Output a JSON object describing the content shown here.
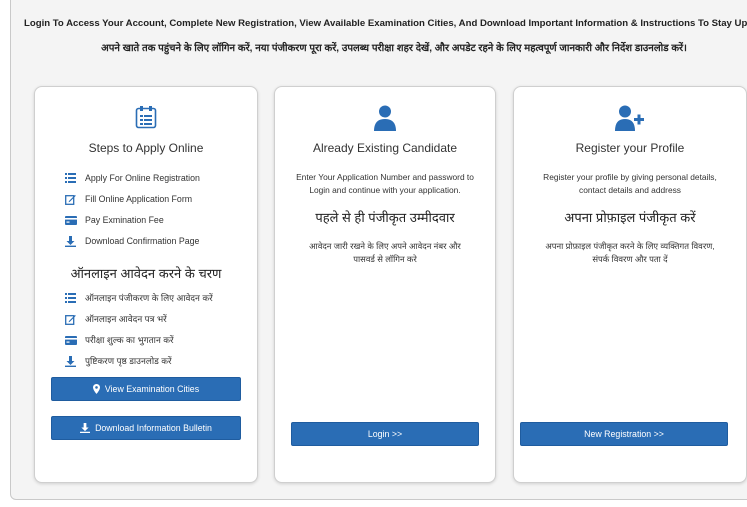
{
  "header": {
    "english": "Login To Access Your Account, Complete New Registration, View Available Examination Cities, And Download Important Information & Instructions To Stay Updated.",
    "hindi": "अपने खाते तक पहुंचने के लिए लॉगिन करें, नया पंजीकरण पूरा करें, उपलब्ध परीक्षा शहर देखें, और अपडेट रहने के लिए महत्वपूर्ण जानकारी और निर्देश डाउनलोड करें।"
  },
  "steps_card": {
    "title": "Steps to Apply Online",
    "steps": [
      {
        "label": "Apply For Online Registration",
        "icon": "list-icon"
      },
      {
        "label": "Fill Online Application Form",
        "icon": "edit-icon"
      },
      {
        "label": "Pay Exmination Fee",
        "icon": "credit-card-icon"
      },
      {
        "label": "Download Confirmation Page",
        "icon": "download-icon"
      }
    ],
    "hindi_title": "ऑनलाइन आवेदन करने के चरण",
    "hindi_steps": [
      {
        "label": "ऑनलाइन पंजीकरण के लिए आवेदन करें",
        "icon": "list-icon"
      },
      {
        "label": "ऑनलाइन आवेदन पत्र भरें",
        "icon": "edit-icon"
      },
      {
        "label": "परीक्षा शुल्क का भुगतान करें",
        "icon": "credit-card-icon"
      },
      {
        "label": "पुष्टिकरण पृष्ठ डाउनलोड करें",
        "icon": "download-icon"
      }
    ],
    "view_cities_label": "View Examination Cities",
    "download_bulletin_label": "Download Information Bulletin"
  },
  "existing_card": {
    "title": "Already Existing Candidate",
    "description": "Enter Your Application Number and password to Login and continue with your application.",
    "hindi_title": "पहले से ही पंजीकृत उम्मीदवार",
    "hindi_description": "आवेदन जारी रखने के लिए अपने आवेदन नंबर और पासवर्ड से लॉगिन करे",
    "login_label": "Login >>"
  },
  "register_card": {
    "title": "Register your Profile",
    "description": "Register your profile by giving personal details, contact details and address",
    "hindi_title": "अपना प्रोफ़ाइल पंजीकृत करें",
    "hindi_description": "अपना प्रोफ़ाइल पंजीकृत करने के लिए व्यक्तिगत विवरण, संपर्क विवरण और पता दें",
    "register_label": "New Registration >>"
  },
  "colors": {
    "accent": "#2a6db5",
    "background": "#f4f4f4",
    "card": "#ffffff"
  }
}
